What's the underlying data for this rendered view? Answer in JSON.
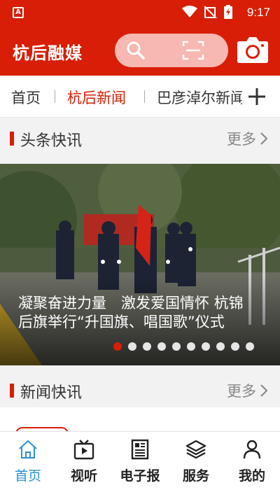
{
  "status_bar": {
    "app_icon": "A",
    "time": "9:17",
    "icons": [
      "wifi-icon",
      "no-signal-icon",
      "battery-icon"
    ]
  },
  "header": {
    "logo": "杭后融媒",
    "icons": [
      "search-icon",
      "scan-icon",
      "camera-icon"
    ],
    "accent_color": "#d81e06"
  },
  "channels": {
    "tabs": [
      {
        "label": "首页",
        "active": false
      },
      {
        "label": "杭后新闻",
        "active": true
      },
      {
        "label": "巴彦淖尔新闻",
        "active": false
      }
    ],
    "add_icon": "plus-icon"
  },
  "headline_section": {
    "title": "头条快讯",
    "more": "更多"
  },
  "banner": {
    "caption": "凝聚奋进力量　激发爱国情怀 杭锦后旗举行“升国旗、唱国歌”仪式",
    "slide_count": 10,
    "active_slide": 1
  },
  "news_section": {
    "title": "新闻快讯",
    "more": "更多"
  },
  "bottom_nav": {
    "items": [
      {
        "label": "首页",
        "icon": "home-icon",
        "active": true
      },
      {
        "label": "视听",
        "icon": "video-icon",
        "active": false
      },
      {
        "label": "电子报",
        "icon": "newspaper-icon",
        "active": false
      },
      {
        "label": "服务",
        "icon": "layers-icon",
        "active": false
      },
      {
        "label": "我的",
        "icon": "user-icon",
        "active": false
      }
    ],
    "active_color": "#2a8fd8"
  }
}
